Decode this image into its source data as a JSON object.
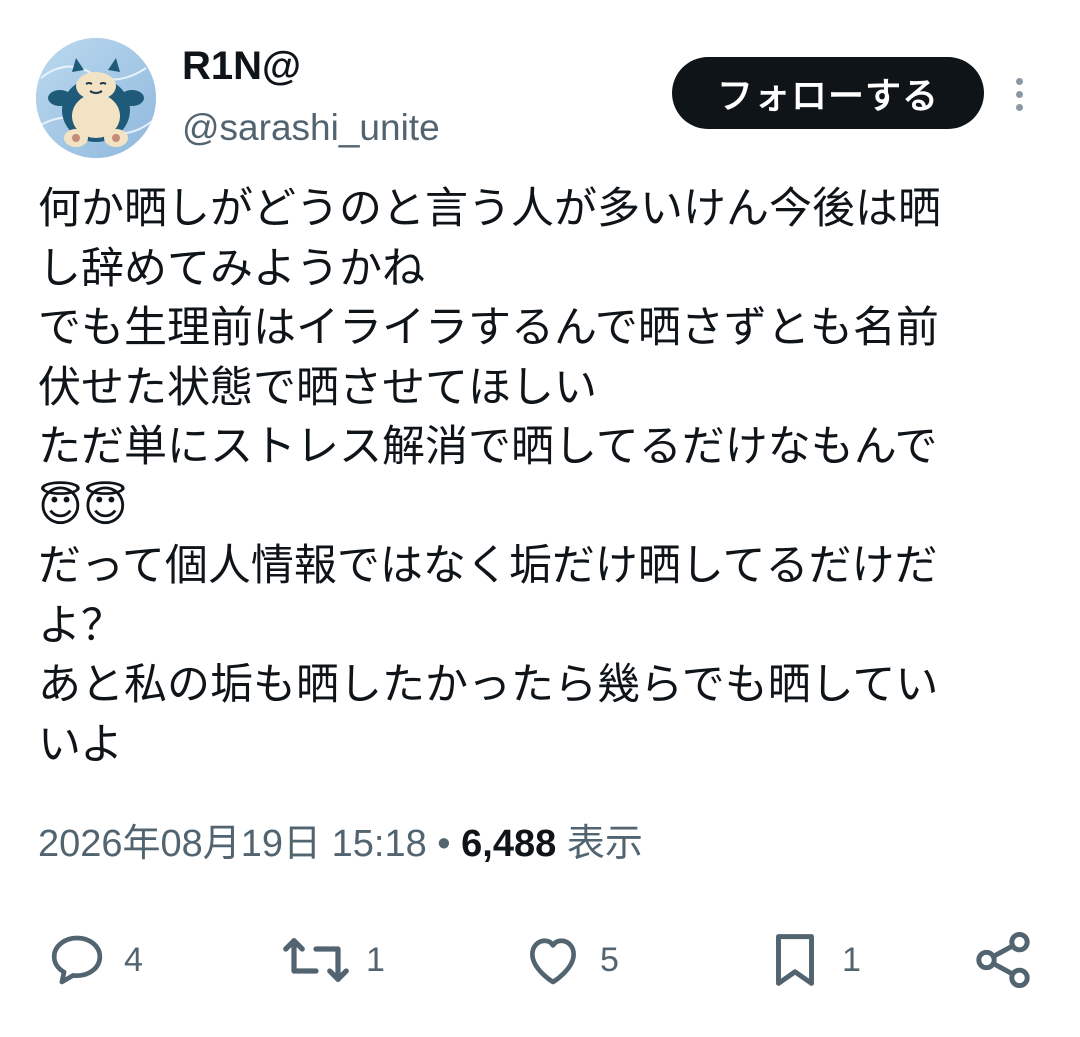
{
  "author": {
    "display_name": "R1N@",
    "handle": "@sarashi_unite",
    "avatar_icon": "snorlax-avatar"
  },
  "follow_button": {
    "label": "フォローする"
  },
  "more_icon": "more-vertical-icon",
  "tweet": {
    "lines": [
      "何か晒しがどうのと言う人が多いけん今後は晒",
      "し辞めてみようかね",
      "でも生理前はイライラするんで晒さずとも名前",
      "伏せた状態で晒させてほしい",
      "ただ単にストレス解消で晒してるだけなもんで",
      "😇😇",
      "だって個人情報ではなく垢だけ晒してるだけだ",
      "よ？",
      "あと私の垢も晒したかったら幾らでも晒してい",
      "いよ"
    ]
  },
  "meta": {
    "timestamp": "2026年08月19日 15:18",
    "separator": "•",
    "views_count": "6,488",
    "views_label": "表示"
  },
  "actions": {
    "reply": {
      "icon": "reply-icon",
      "count": "4"
    },
    "retweet": {
      "icon": "retweet-icon",
      "count": "1"
    },
    "like": {
      "icon": "heart-icon",
      "count": "5"
    },
    "bookmark": {
      "icon": "bookmark-icon",
      "count": "1"
    },
    "share": {
      "icon": "share-icon"
    }
  },
  "colors": {
    "text_primary": "#0f1419",
    "text_secondary": "#536471",
    "follow_bg": "#0f1419",
    "follow_text": "#ffffff"
  }
}
